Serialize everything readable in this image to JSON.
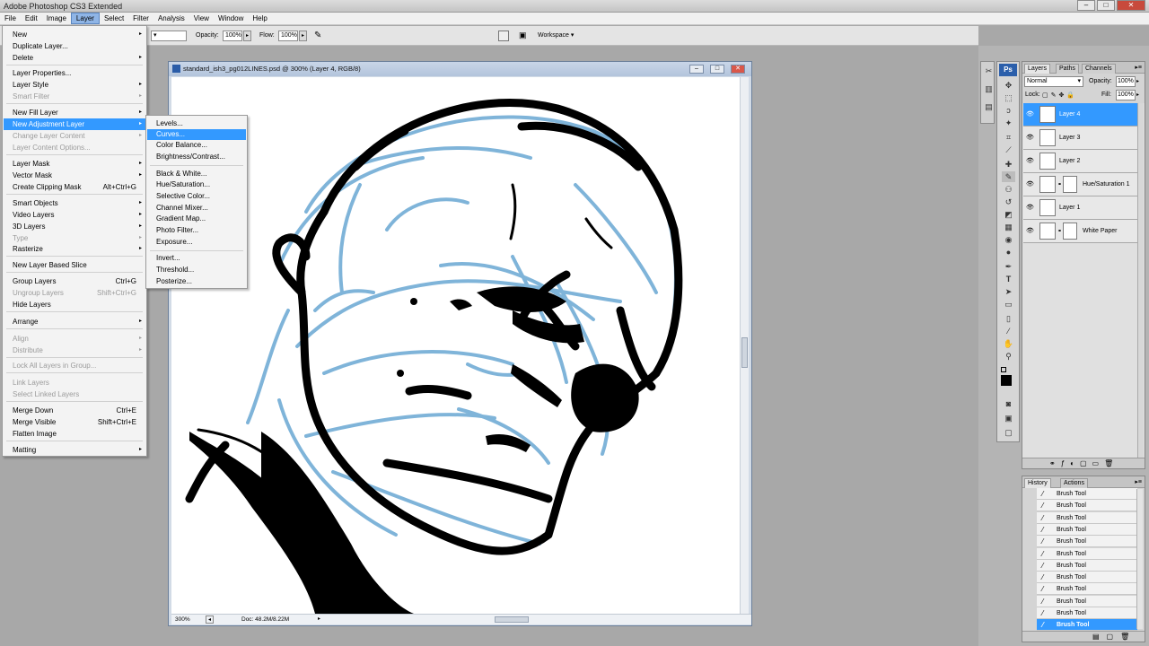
{
  "app": {
    "title": "Adobe Photoshop CS3 Extended"
  },
  "window_controls": {
    "minimize": "–",
    "maximize": "□",
    "close": "✕"
  },
  "menubar": [
    "File",
    "Edit",
    "Image",
    "Layer",
    "Select",
    "Filter",
    "Analysis",
    "View",
    "Window",
    "Help"
  ],
  "options": {
    "opacity_label": "Opacity:",
    "opacity_value": "100%",
    "flow_label": "Flow:",
    "flow_value": "100%",
    "workspace_label": "Workspace ▾"
  },
  "document": {
    "title": "standard_ish3_pg012LINES.psd @ 300% (Layer 4, RGB/8)",
    "zoom": "300%",
    "doc_size": "Doc: 48.2M/8.22M"
  },
  "layer_menu": [
    {
      "label": "New",
      "arrow": true
    },
    {
      "label": "Duplicate Layer..."
    },
    {
      "label": "Delete",
      "arrow": true
    },
    {
      "sep": true
    },
    {
      "label": "Layer Properties..."
    },
    {
      "label": "Layer Style",
      "arrow": true
    },
    {
      "label": "Smart Filter",
      "disabled": true,
      "arrow": true
    },
    {
      "sep": true
    },
    {
      "label": "New Fill Layer",
      "arrow": true
    },
    {
      "label": "New Adjustment Layer",
      "arrow": true,
      "selected": true
    },
    {
      "label": "Change Layer Content",
      "disabled": true,
      "arrow": true
    },
    {
      "label": "Layer Content Options...",
      "disabled": true
    },
    {
      "sep": true
    },
    {
      "label": "Layer Mask",
      "arrow": true
    },
    {
      "label": "Vector Mask",
      "arrow": true
    },
    {
      "label": "Create Clipping Mask",
      "shortcut": "Alt+Ctrl+G"
    },
    {
      "sep": true
    },
    {
      "label": "Smart Objects",
      "arrow": true
    },
    {
      "label": "Video Layers",
      "arrow": true
    },
    {
      "label": "3D Layers",
      "arrow": true
    },
    {
      "label": "Type",
      "disabled": true,
      "arrow": true
    },
    {
      "label": "Rasterize",
      "arrow": true
    },
    {
      "sep": true
    },
    {
      "label": "New Layer Based Slice"
    },
    {
      "sep": true
    },
    {
      "label": "Group Layers",
      "shortcut": "Ctrl+G"
    },
    {
      "label": "Ungroup Layers",
      "disabled": true,
      "shortcut": "Shift+Ctrl+G"
    },
    {
      "label": "Hide Layers"
    },
    {
      "sep": true
    },
    {
      "label": "Arrange",
      "arrow": true
    },
    {
      "sep": true
    },
    {
      "label": "Align",
      "disabled": true,
      "arrow": true
    },
    {
      "label": "Distribute",
      "disabled": true,
      "arrow": true
    },
    {
      "sep": true
    },
    {
      "label": "Lock All Layers in Group...",
      "disabled": true
    },
    {
      "sep": true
    },
    {
      "label": "Link Layers",
      "disabled": true
    },
    {
      "label": "Select Linked Layers",
      "disabled": true
    },
    {
      "sep": true
    },
    {
      "label": "Merge Down",
      "shortcut": "Ctrl+E"
    },
    {
      "label": "Merge Visible",
      "shortcut": "Shift+Ctrl+E"
    },
    {
      "label": "Flatten Image"
    },
    {
      "sep": true
    },
    {
      "label": "Matting",
      "arrow": true
    }
  ],
  "adjustment_submenu": [
    {
      "label": "Levels..."
    },
    {
      "label": "Curves...",
      "selected": true
    },
    {
      "label": "Color Balance..."
    },
    {
      "label": "Brightness/Contrast..."
    },
    {
      "sep": true
    },
    {
      "label": "Black & White..."
    },
    {
      "label": "Hue/Saturation..."
    },
    {
      "label": "Selective Color..."
    },
    {
      "label": "Channel Mixer..."
    },
    {
      "label": "Gradient Map..."
    },
    {
      "label": "Photo Filter..."
    },
    {
      "label": "Exposure..."
    },
    {
      "sep": true
    },
    {
      "label": "Invert..."
    },
    {
      "label": "Threshold..."
    },
    {
      "label": "Posterize..."
    }
  ],
  "layers_panel": {
    "tabs": [
      "Layers",
      "Paths",
      "Channels"
    ],
    "blend_mode": "Normal",
    "opacity_label": "Opacity:",
    "opacity_value": "100%",
    "lock_label": "Lock:",
    "fill_label": "Fill:",
    "fill_value": "100%",
    "layers": [
      {
        "name": "Layer 4",
        "selected": true
      },
      {
        "name": "Layer 3"
      },
      {
        "name": "Layer 2"
      },
      {
        "name": "Hue/Saturation 1",
        "adjustment": true
      },
      {
        "name": "Layer 1"
      },
      {
        "name": "White Paper",
        "adjustment": true
      }
    ]
  },
  "history_panel": {
    "tabs": [
      "History",
      "Actions"
    ],
    "items": [
      "Brush Tool",
      "Brush Tool",
      "Brush Tool",
      "Brush Tool",
      "Brush Tool",
      "Brush Tool",
      "Brush Tool",
      "Brush Tool",
      "Brush Tool",
      "Brush Tool",
      "Brush Tool",
      "Brush Tool"
    ],
    "selected_index": 11
  },
  "colors": {
    "menu_highlight": "#3399ff",
    "sketch_blue": "#7fb4d9",
    "ink": "#000000"
  }
}
